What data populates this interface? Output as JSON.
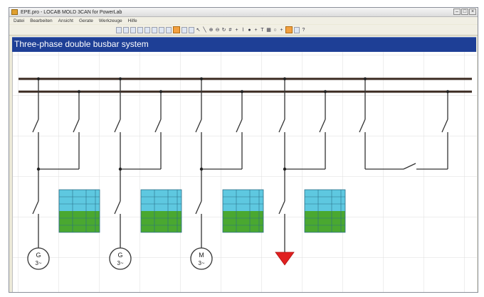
{
  "window": {
    "title": "EPE.pro - LOCAB MOLD 3CAN for PowerLab"
  },
  "menu": [
    "Datei",
    "Bearbeiten",
    "Ansicht",
    "Gerate",
    "Werkzeuge",
    "Hilfe"
  ],
  "document": {
    "title": "Three-phase double busbar system"
  },
  "symbols": {
    "generator_1": {
      "top": "G",
      "bottom": "3~"
    },
    "generator_2": {
      "top": "G",
      "bottom": "3~"
    },
    "motor_1": {
      "top": "M",
      "bottom": "3~"
    }
  },
  "colors": {
    "header_bg": "#1e3f96",
    "meter_cyan": "#5ec8e0",
    "meter_green": "#4aa830",
    "load_red": "#e02020",
    "busbar": "#3a2a20"
  }
}
